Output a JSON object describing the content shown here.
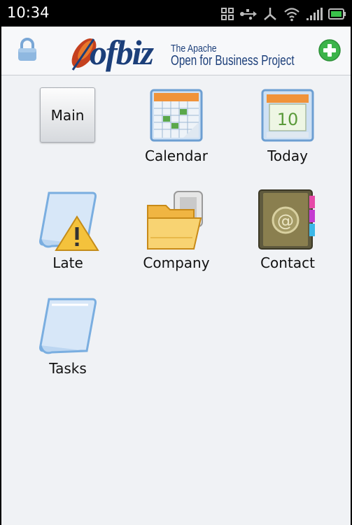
{
  "statusbar": {
    "time": "10:34"
  },
  "header": {
    "logo_word": "ofbiz",
    "logo_line1": "The Apache",
    "logo_line2": "Open for Business Project"
  },
  "grid": {
    "main_label": "Main",
    "calendar_label": "Calendar",
    "calendar_day": "10",
    "today_label": "Today",
    "late_label": "Late",
    "company_label": "Company",
    "contact_label": "Contact",
    "tasks_label": "Tasks"
  },
  "icons": [
    "lock-icon",
    "add-icon",
    "calendar-icon",
    "today-icon",
    "late-icon",
    "company-icon",
    "contact-icon",
    "tasks-icon"
  ],
  "colors": {
    "header_bg": "#f7f8fa",
    "body_bg": "#f0f2f5",
    "brand": "#1c3f7a",
    "add_green": "#3cb44a"
  }
}
